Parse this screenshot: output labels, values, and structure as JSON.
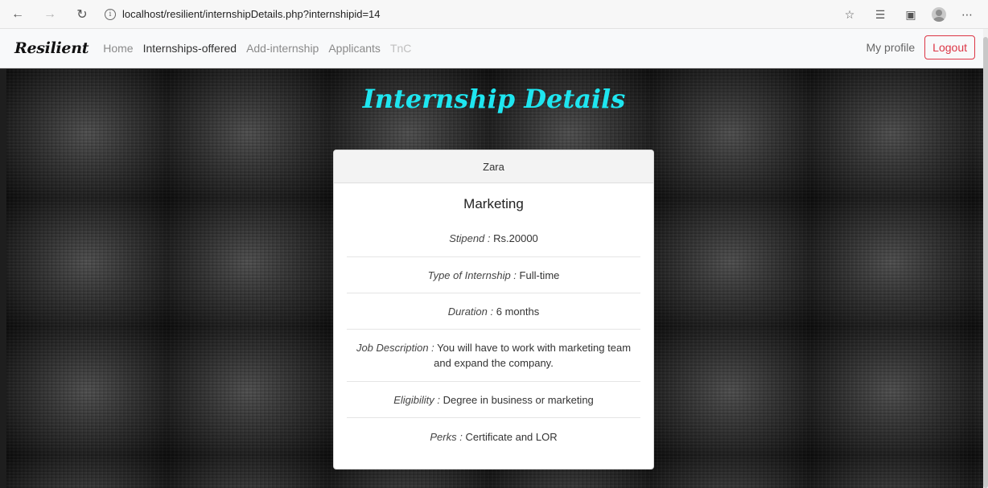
{
  "browser": {
    "url_host": "localhost",
    "url_path": "/resilient/internshipDetails.php?internshipid=14"
  },
  "navbar": {
    "brand": "Resilient",
    "links": [
      {
        "label": "Home",
        "state": "normal"
      },
      {
        "label": "Internships-offered",
        "state": "active"
      },
      {
        "label": "Add-internship",
        "state": "normal"
      },
      {
        "label": "Applicants",
        "state": "normal"
      },
      {
        "label": "TnC",
        "state": "disabled"
      }
    ],
    "profile_label": "My profile",
    "logout_label": "Logout"
  },
  "page": {
    "title": "Internship Details",
    "title_color": "#1ee6f0"
  },
  "card": {
    "company": "Zara",
    "role": "Marketing",
    "details": [
      {
        "label": "Stipend :",
        "value": "Rs.20000"
      },
      {
        "label": "Type of Internship :",
        "value": "Full-time"
      },
      {
        "label": "Duration :",
        "value": "6 months"
      },
      {
        "label": "Job Description :",
        "value": "You will have to work with marketing team and expand the company."
      },
      {
        "label": "Eligibility :",
        "value": "Degree in business or marketing"
      },
      {
        "label": "Perks :",
        "value": "Certificate and LOR"
      }
    ]
  },
  "colors": {
    "logout": "#dc3545",
    "navbar_bg": "#f8f9fa"
  }
}
